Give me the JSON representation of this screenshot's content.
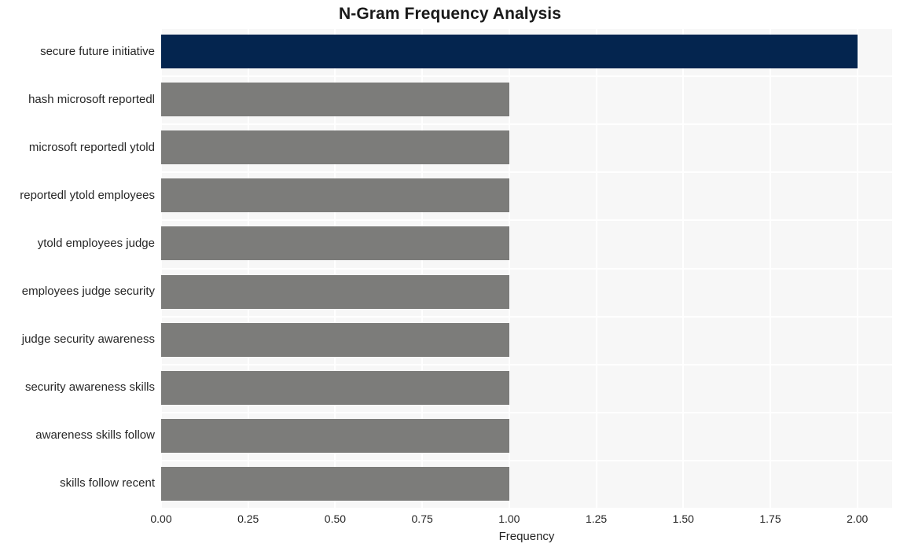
{
  "chart_data": {
    "type": "bar",
    "orientation": "horizontal",
    "title": "N-Gram Frequency Analysis",
    "xlabel": "Frequency",
    "ylabel": "",
    "categories": [
      "secure future initiative",
      "hash microsoft reportedl",
      "microsoft reportedl ytold",
      "reportedl ytold employees",
      "ytold employees judge",
      "employees judge security",
      "judge security awareness",
      "security awareness skills",
      "awareness skills follow",
      "skills follow recent"
    ],
    "values": [
      2,
      1,
      1,
      1,
      1,
      1,
      1,
      1,
      1,
      1
    ],
    "bar_colors": [
      "#04254f",
      "#7c7c7a",
      "#7c7c7a",
      "#7c7c7a",
      "#7c7c7a",
      "#7c7c7a",
      "#7c7c7a",
      "#7c7c7a",
      "#7c7c7a",
      "#7c7c7a"
    ],
    "xlim": [
      0,
      2.1
    ],
    "xticks": [
      "0.00",
      "0.25",
      "0.50",
      "0.75",
      "1.00",
      "1.25",
      "1.50",
      "1.75",
      "2.00"
    ],
    "xtick_values": [
      0,
      0.25,
      0.5,
      0.75,
      1,
      1.25,
      1.5,
      1.75,
      2
    ],
    "grid": true,
    "grid_color": "#ffffff",
    "legend": null,
    "plot_background": "#f7f7f7",
    "figure_background": "#ffffff"
  }
}
